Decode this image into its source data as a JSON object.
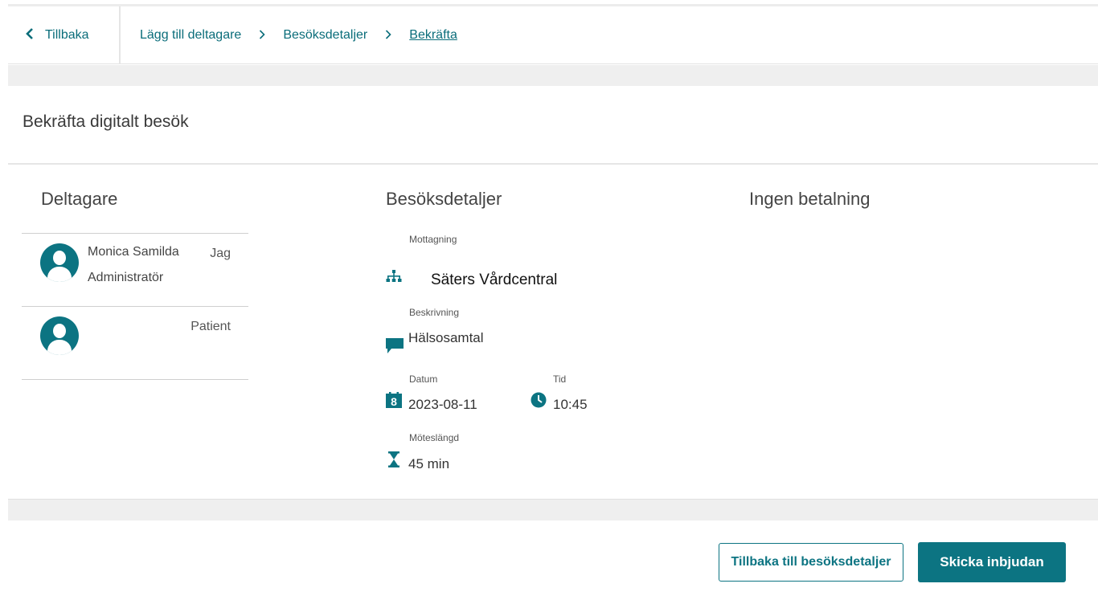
{
  "nav": {
    "back_label": "Tillbaka",
    "breadcrumbs": [
      "Lägg till deltagare",
      "Besöksdetaljer",
      "Bekräfta"
    ]
  },
  "page_title": "Bekräfta digitalt besök",
  "participants": {
    "title": "Deltagare",
    "items": [
      {
        "name": "Monica Samilda",
        "role": "Administratör",
        "tag": "Jag"
      },
      {
        "name": "",
        "role": "",
        "tag": "Patient"
      }
    ]
  },
  "details": {
    "title": "Besöksdetaljer",
    "reception_label": "Mottagning",
    "reception_value": "Säters Vårdcentral",
    "description_label": "Beskrivning",
    "description_value": "Hälsosamtal",
    "date_label": "Datum",
    "date_value": "2023-08-11",
    "time_label": "Tid",
    "time_value": "10:45",
    "length_label": "Möteslängd",
    "length_value": "45 min",
    "calendar_day": "8"
  },
  "payment": {
    "title": "Ingen betalning"
  },
  "buttons": {
    "back_to_details": "Tillbaka till besöksdetaljer",
    "send_invite": "Skicka inbjudan"
  },
  "colors": {
    "accent": "#0c7482",
    "link": "#0a6d7a"
  },
  "icons": [
    "chevron-left-icon",
    "chevron-right-icon",
    "avatar-icon",
    "org-chart-icon",
    "comment-icon",
    "calendar-icon",
    "clock-icon",
    "hourglass-icon"
  ]
}
